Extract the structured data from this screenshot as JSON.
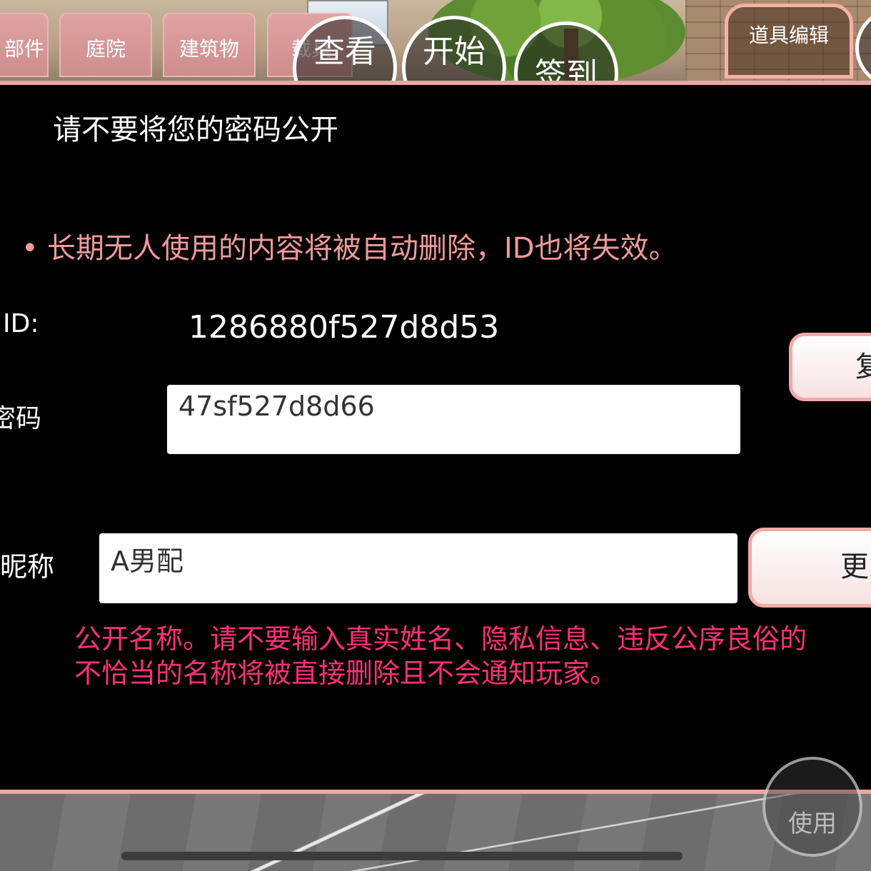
{
  "background": {
    "tabs": [
      "部件",
      "庭院",
      "建筑物",
      "载具"
    ],
    "round_buttons": [
      "查看",
      "开始",
      "签到"
    ],
    "prop_edit": "道具编辑",
    "use_button": "使用"
  },
  "dialog": {
    "title": "请不要将您的密码公开",
    "bullet": "•",
    "notice": "长期无人使用的内容将被自动删除，ID也将失效。",
    "id_label": "ID:",
    "id_value": "1286880f527d8d53",
    "copy_button": "复制",
    "password_label": "密码",
    "password_value": "47sf527d8d66",
    "nickname_label": "昵称",
    "nickname_value": "A男配",
    "change_button": "更改",
    "warning_line1": "公开名称。请不要输入真实姓名、隐私信息、违反公序良俗的",
    "warning_line2": "不恰当的名称将被直接删除且不会通知玩家。"
  },
  "colors": {
    "dialog_border": "#f1a4a4",
    "notice_text": "#f19a9a",
    "warning_text": "#ff2f7a",
    "tab_fill": "#cf8c8c"
  }
}
